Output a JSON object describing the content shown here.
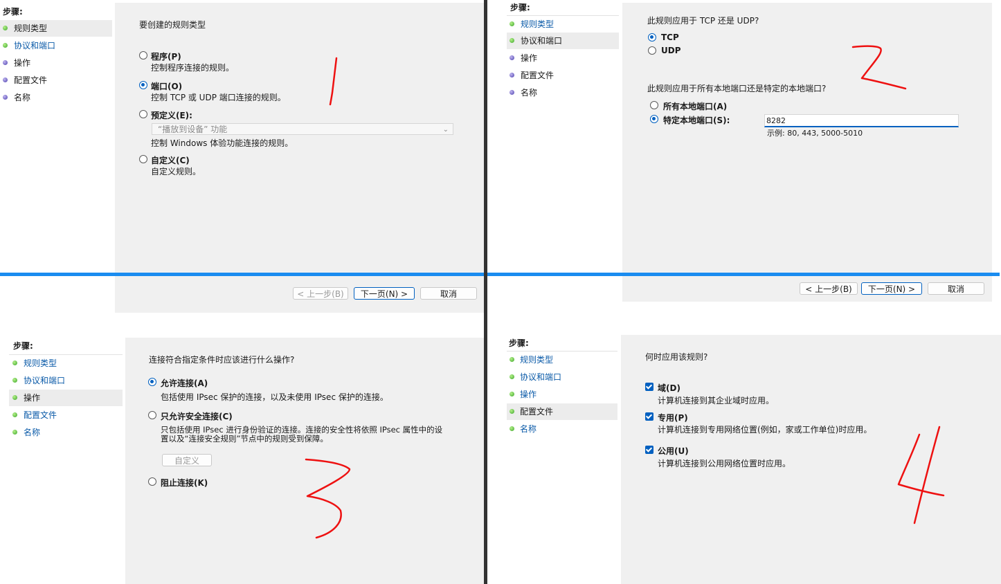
{
  "panel1": {
    "steps_title": "步骤:",
    "steps": [
      "规则类型",
      "协议和端口",
      "操作",
      "配置文件",
      "名称"
    ],
    "question": "要创建的规则类型",
    "options": [
      {
        "label": "程序(P)",
        "desc": "控制程序连接的规则。"
      },
      {
        "label": "端口(O)",
        "desc": "控制 TCP 或 UDP 端口连接的规则。"
      },
      {
        "label": "预定义(E):",
        "dropdown": "“播放到设备” 功能",
        "desc": "控制 Windows 体验功能连接的规则。"
      },
      {
        "label": "自定义(C)",
        "desc": "自定义规则。"
      }
    ],
    "buttons": {
      "back": "< 上一步(B)",
      "next": "下一页(N) >",
      "cancel": "取消"
    },
    "annotation": "1"
  },
  "panel2": {
    "steps_title": "步骤:",
    "steps": [
      "规则类型",
      "协议和端口",
      "操作",
      "配置文件",
      "名称"
    ],
    "question1": "此规则应用于 TCP 还是 UDP?",
    "protocols": [
      "TCP",
      "UDP"
    ],
    "question2": "此规则应用于所有本地端口还是特定的本地端口?",
    "port_options": [
      "所有本地端口(A)",
      "特定本地端口(S):"
    ],
    "port_value": "8282",
    "port_example": "示例: 80, 443, 5000-5010",
    "buttons": {
      "back": "< 上一步(B)",
      "next": "下一页(N) >",
      "cancel": "取消"
    },
    "annotation": "2"
  },
  "panel3": {
    "steps_title": "步骤:",
    "steps": [
      "规则类型",
      "协议和端口",
      "操作",
      "配置文件",
      "名称"
    ],
    "question": "连接符合指定条件时应该进行什么操作?",
    "options": [
      {
        "label": "允许连接(A)",
        "desc": "包括使用 IPsec 保护的连接，以及未使用 IPsec 保护的连接。"
      },
      {
        "label": "只允许安全连接(C)",
        "desc1": "只包括使用 IPsec 进行身份验证的连接。连接的安全性将依照 IPsec 属性中的设",
        "desc2": "置以及“连接安全规则”节点中的规则受到保障。",
        "button": "自定义"
      },
      {
        "label": "阻止连接(K)"
      }
    ],
    "annotation": "3"
  },
  "panel4": {
    "steps_title": "步骤:",
    "steps": [
      "规则类型",
      "协议和端口",
      "操作",
      "配置文件",
      "名称"
    ],
    "question": "何时应用该规则?",
    "profiles": [
      {
        "label": "域(D)",
        "desc": "计算机连接到其企业域时应用。"
      },
      {
        "label": "专用(P)",
        "desc": "计算机连接到专用网络位置(例如，家或工作单位)时应用。"
      },
      {
        "label": "公用(U)",
        "desc": "计算机连接到公用网络位置时应用。"
      }
    ],
    "annotation": "4"
  },
  "colors": {
    "accent": "#0060c0",
    "divider_blue": "#1a8cf0",
    "divider_dark": "#333333",
    "annotation": "#ee1111"
  }
}
